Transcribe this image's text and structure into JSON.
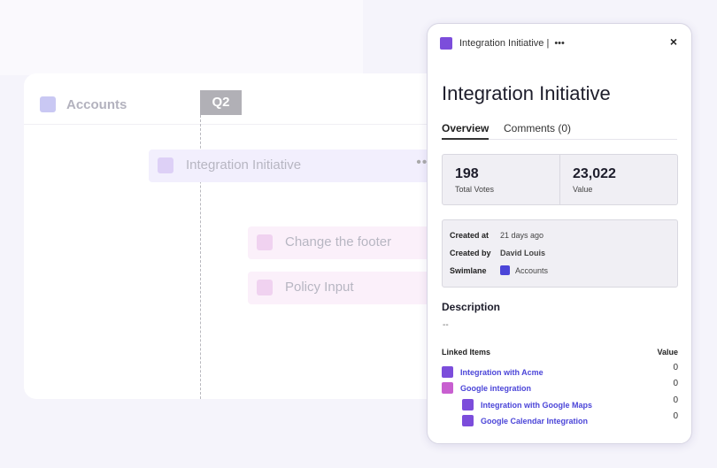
{
  "board": {
    "swimlane": "Accounts",
    "quarter": "Q2",
    "bars": [
      {
        "label": "Integration Initiative",
        "more": "•••"
      },
      {
        "label": "Change the footer"
      },
      {
        "label": "Policy Input"
      }
    ]
  },
  "panel": {
    "header_title": "Integration Initiative |",
    "more": "•••",
    "close": "×",
    "title": "Integration Initiative",
    "tabs": [
      "Overview",
      "Comments (0)"
    ],
    "stats": [
      {
        "value": "198",
        "label": "Total Votes"
      },
      {
        "value": "23,022",
        "label": "Value"
      }
    ],
    "meta": {
      "created_at_label": "Created at",
      "created_at": "21 days ago",
      "created_by_label": "Created by",
      "created_by": "David Louis",
      "swimlane_label": "Swimlane",
      "swimlane": "Accounts"
    },
    "description_label": "Description",
    "description": "--",
    "linked_header": "Linked Items",
    "value_header": "Value",
    "linked": [
      {
        "name": "Integration with Acme",
        "value": "0",
        "color": "#7c4ddb"
      },
      {
        "name": "Google integration",
        "value": "0",
        "color": "#c85fd0"
      },
      {
        "name": "Integration with Google Maps",
        "value": "0",
        "color": "#7c4ddb"
      },
      {
        "name": "Google Calendar Integration",
        "value": "0",
        "color": "#7c4ddb"
      }
    ]
  },
  "colors": {
    "accent": "#7c4ddb",
    "link": "#4b45d8",
    "swimlane": "#4b45d8"
  }
}
